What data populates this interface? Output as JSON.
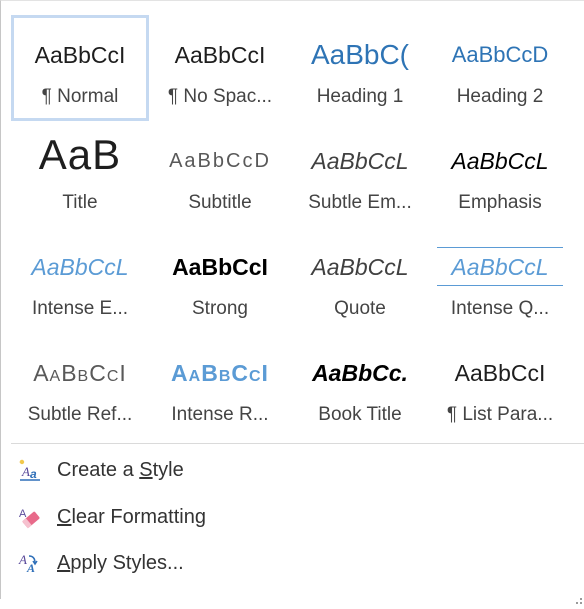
{
  "styles": [
    {
      "sample": "AaBbCcI",
      "label": "¶ Normal"
    },
    {
      "sample": "AaBbCcI",
      "label": "¶ No Spac..."
    },
    {
      "sample": "AaBbC(",
      "label": "Heading 1"
    },
    {
      "sample": "AaBbCcD",
      "label": "Heading 2"
    },
    {
      "sample": "AaB",
      "label": "Title"
    },
    {
      "sample": "AaBbCcD",
      "label": "Subtitle"
    },
    {
      "sample": "AaBbCcL",
      "label": "Subtle Em..."
    },
    {
      "sample": "AaBbCcL",
      "label": "Emphasis"
    },
    {
      "sample": "AaBbCcL",
      "label": "Intense E..."
    },
    {
      "sample": "AaBbCcI",
      "label": "Strong"
    },
    {
      "sample": "AaBbCcL",
      "label": "Quote"
    },
    {
      "sample": "AaBbCcL",
      "label": "Intense Q..."
    },
    {
      "sample": "AaBbCcI",
      "label": "Subtle Ref..."
    },
    {
      "sample": "AaBbCcI",
      "label": "Intense R..."
    },
    {
      "sample": "AaBbCc.",
      "label": "Book Title"
    },
    {
      "sample": "AaBbCcI",
      "label": "¶ List Para..."
    }
  ],
  "menu": {
    "create_style": {
      "before": "Create a ",
      "accel": "S",
      "after": "tyle"
    },
    "clear_formatting": {
      "before": "",
      "accel": "C",
      "after": "lear Formatting"
    },
    "apply_styles": {
      "before": "",
      "accel": "A",
      "after": "pply Styles..."
    }
  },
  "colors": {
    "accent": "#5b9bd5",
    "heading": "#2e74b5",
    "selection_border": "#c5d9f1"
  }
}
